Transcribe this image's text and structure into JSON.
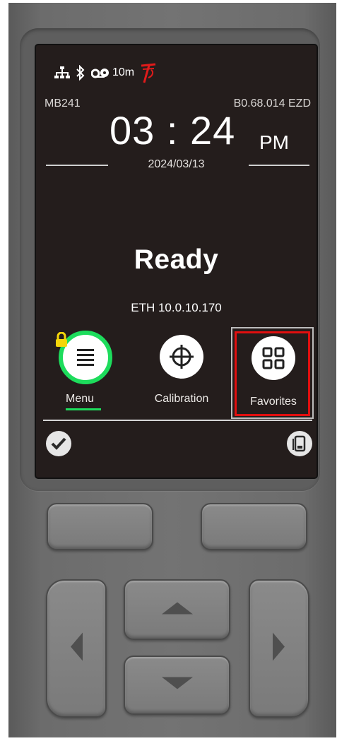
{
  "statusbar": {
    "icons": [
      "ethernet-icon",
      "bluetooth-icon",
      "ribbon-icon",
      "tsc-logo-icon"
    ],
    "ribbon_remaining": "10m"
  },
  "header": {
    "model": "MB241",
    "firmware": "B0.68.014 EZD",
    "time": "03 : 24",
    "ampm": "PM",
    "date": "2024/03/13"
  },
  "main": {
    "status": "Ready",
    "network": "ETH 10.0.10.170"
  },
  "tiles": [
    {
      "label": "Menu",
      "icon": "menu-list-icon",
      "locked": true,
      "accent": "#1ddc5c"
    },
    {
      "label": "Calibration",
      "icon": "crosshair-icon"
    },
    {
      "label": "Favorites",
      "icon": "grid-icon",
      "selected": true,
      "highlight": "#e10f0f"
    }
  ],
  "softkeys": {
    "left_icon": "check-icon",
    "right_icon": "device-icon"
  },
  "colors": {
    "screen_bg": "#241d1c",
    "accent_green": "#1ddc5c",
    "highlight_red": "#e10f0f",
    "logo_red": "#e01b1b"
  }
}
